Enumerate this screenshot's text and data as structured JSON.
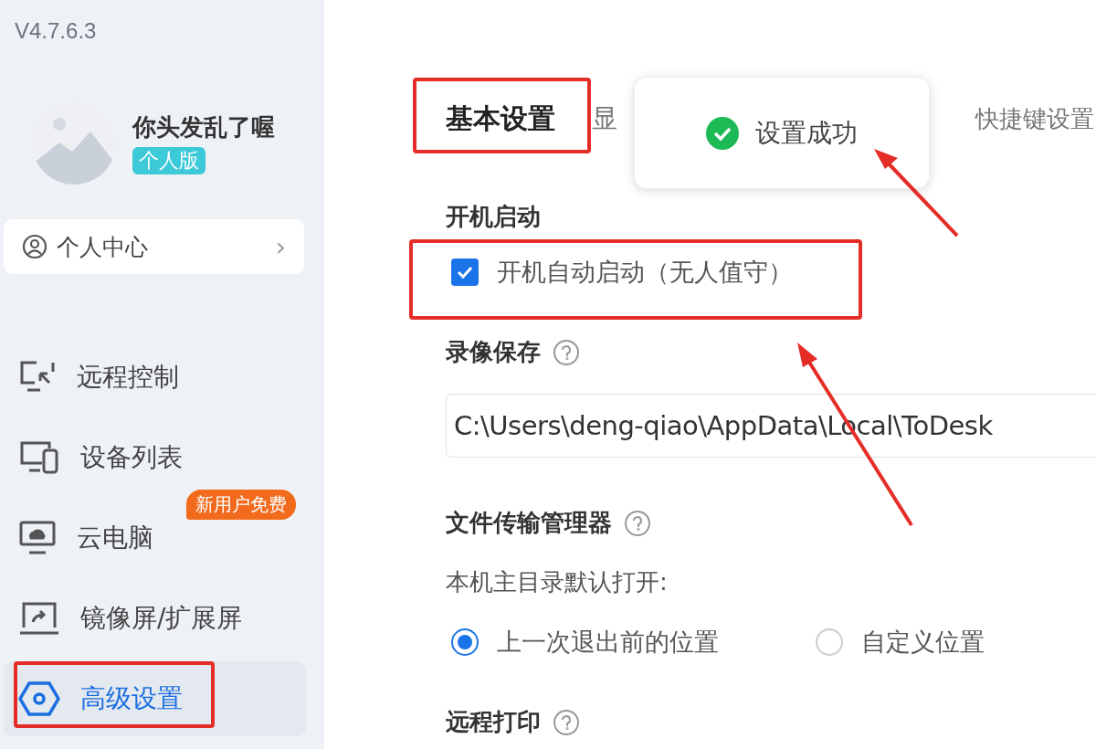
{
  "sidebar": {
    "version": "V4.7.6.3",
    "profile": {
      "name": "你头发乱了喔",
      "plan": "个人版"
    },
    "personal_center": {
      "label": "个人中心",
      "chevron": "›"
    },
    "items": [
      {
        "label": "远程控制",
        "selected": false
      },
      {
        "label": "设备列表",
        "selected": false
      },
      {
        "label": "云电脑",
        "selected": false,
        "badge": "新用户免费"
      },
      {
        "label": "镜像屏/扩展屏",
        "selected": false
      },
      {
        "label": "高级设置",
        "selected": true
      }
    ]
  },
  "tabs": [
    {
      "label": "基本设置",
      "selected": true
    },
    {
      "label": "显",
      "selected": false
    },
    {
      "label": "快捷键设置",
      "selected": false
    }
  ],
  "toast": {
    "message": "设置成功"
  },
  "sections": [
    {
      "title": "开机启动",
      "kind": "checkbox",
      "option": {
        "label": "开机自动启动（无人值守）",
        "checked": true
      }
    },
    {
      "title": "录像保存",
      "help": true,
      "kind": "path",
      "value": "C:\\Users\\deng-qiao\\AppData\\Local\\ToDesk"
    },
    {
      "title": "文件传输管理器",
      "help": true,
      "kind": "radio",
      "prompt": "本机主目录默认打开:",
      "options": [
        {
          "label": "上一次退出前的位置",
          "selected": true
        },
        {
          "label": "自定义位置",
          "selected": false
        }
      ]
    },
    {
      "title": "远程打印",
      "help": true,
      "kind": "heading"
    }
  ]
}
